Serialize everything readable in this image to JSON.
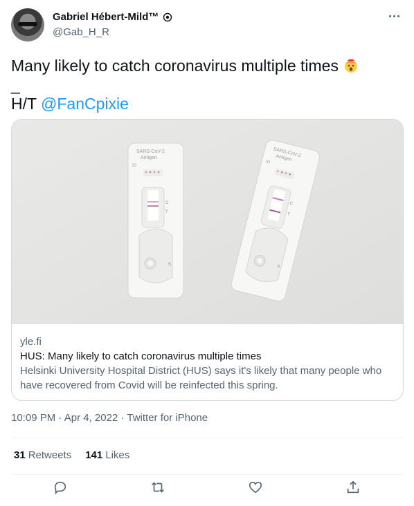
{
  "author": {
    "name": "Gabriel Hébert-Mild™",
    "handle": "@Gab_H_R"
  },
  "tweet": {
    "text": "Many likely to catch coronavirus multiple times",
    "emoji_icon": "exploding-head-icon",
    "separator": "_",
    "ht_prefix": "H/T",
    "mention": "@FanCpixie"
  },
  "card": {
    "image_description_icon": "antigen-test-image",
    "test_label_line1": "SARS-CoV-2",
    "test_label_line2": "Antigen",
    "test_id_label": "ID",
    "test_c_label": "C",
    "test_t_label": "T",
    "test_s_label": "S",
    "domain": "yle.fi",
    "title": "HUS: Many likely to catch coronavirus multiple times",
    "description_line1": "Helsinki University Hospital District (HUS) says it's likely that many people who",
    "description_line2": "have recovered from Covid will be reinfected this spring."
  },
  "meta": {
    "time": "10:09 PM",
    "sep1": "·",
    "date": "Apr 4, 2022",
    "sep2": "·",
    "source": "Twitter for iPhone"
  },
  "stats": {
    "retweets_count": "31",
    "retweets_label": "Retweets",
    "likes_count": "141",
    "likes_label": "Likes"
  },
  "colors": {
    "accent": "#1d9bf0",
    "muted": "#536471",
    "border": "#cfd9de"
  }
}
